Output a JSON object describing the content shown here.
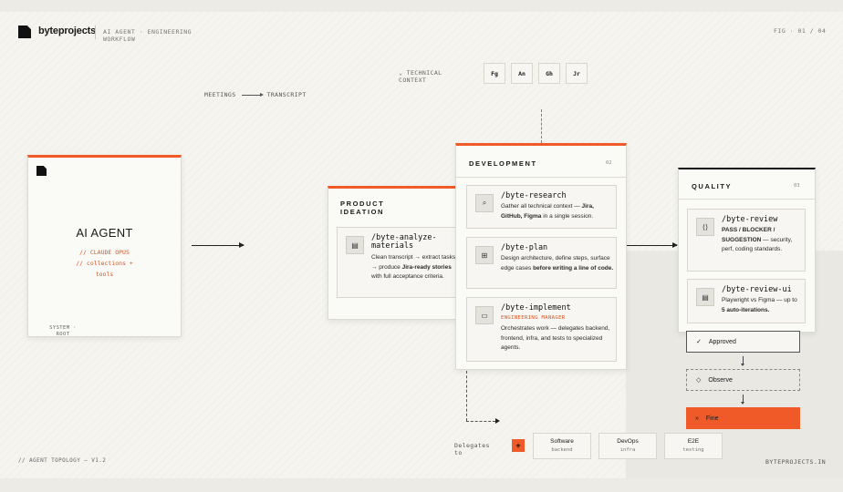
{
  "header": {
    "brand": "byteprojects",
    "subtitle": "AI AGENT · ENGINEERING WORKFLOW",
    "fig": "FIG · 01 / 04"
  },
  "meetings": {
    "from": "MEETINGS",
    "to": "TRANSCRIPT"
  },
  "technical_context": {
    "label": "⌄ TECHNICAL CONTEXT",
    "chips": [
      "Fg",
      "An",
      "Gh",
      "Jr"
    ]
  },
  "agent": {
    "title": "AI AGENT",
    "line1": "// CLAUDE OPUS",
    "line2": "// collections +",
    "line3": "tools",
    "footer": "SYSTEM · ROOT"
  },
  "product": {
    "title": "PRODUCT IDEATION",
    "items": [
      {
        "cmd": "/byte-analyze-materials",
        "desc_a": "Clean transcript → extract tasks → produce ",
        "desc_b": "Jira-ready stories",
        "desc_c": " with full acceptance criteria."
      }
    ]
  },
  "development": {
    "title": "DEVELOPMENT",
    "num": "02",
    "items": [
      {
        "cmd": "/byte-research",
        "desc_a": "Gather all technical context — ",
        "desc_b": "Jira, GitHub, Figma",
        "desc_c": " in a single session."
      },
      {
        "cmd": "/byte-plan",
        "desc_a": "Design architecture, define steps, surface edge cases ",
        "desc_b": "before writing a line of code."
      },
      {
        "cmd": "/byte-implement",
        "tag": "ENGINEERING MANAGER",
        "desc_a": "Orchestrates work — delegates backend, frontend, infra, and tests to specialized agents."
      }
    ]
  },
  "quality": {
    "title": "QUALITY",
    "num": "03",
    "items": [
      {
        "cmd": "/byte-review",
        "desc_b": "PASS / BLOCKER / SUGGESTION",
        "desc_c": " — security, perf, coding standards."
      },
      {
        "cmd": "/byte-review-ui",
        "desc_a": "Playwright vs Figma — up to ",
        "desc_b": "5 auto-iterations."
      }
    ]
  },
  "states": [
    {
      "icon": "✓",
      "label": "Approved"
    },
    {
      "icon": "◇",
      "label": "Observe"
    },
    {
      "icon": "»",
      "label": "Fine"
    }
  ],
  "delegates": {
    "label": "Delegates to",
    "plus": "+",
    "targets": [
      {
        "name": "Software",
        "sub": "backend"
      },
      {
        "name": "DevOps",
        "sub": "infra"
      },
      {
        "name": "E2E",
        "sub": "testing"
      }
    ]
  },
  "footer": {
    "left": "// AGENT TOPOLOGY — V1.2",
    "right": "BYTEPROJECTS.IN"
  },
  "colors": {
    "accent": "#f05a28",
    "ink": "#111111",
    "paper": "#f5f4ef"
  }
}
